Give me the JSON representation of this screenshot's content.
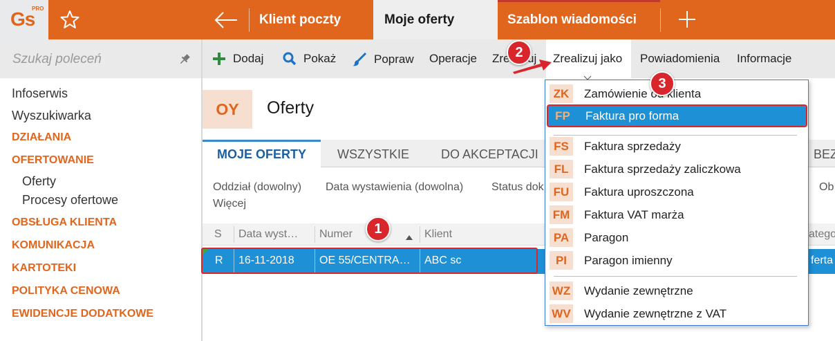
{
  "logo": {
    "text": "Gs",
    "superscript": "PRO"
  },
  "top_tabs": [
    {
      "label": "Klient poczty"
    },
    {
      "label": "Moje oferty"
    },
    {
      "label": "Szablon wiadomości"
    }
  ],
  "sidebar": {
    "search_placeholder": "Szukaj poleceń",
    "items": [
      {
        "label": "Infoserwis",
        "kind": "plain"
      },
      {
        "label": "Wyszukiwarka",
        "kind": "plain"
      },
      {
        "label": "DZIAŁANIA",
        "kind": "section"
      },
      {
        "label": "OFERTOWANIE",
        "kind": "section"
      },
      {
        "label": "Oferty",
        "kind": "sub"
      },
      {
        "label": "Procesy ofertowe",
        "kind": "sub"
      },
      {
        "label": "OBSŁUGA KLIENTA",
        "kind": "section"
      },
      {
        "label": "KOMUNIKACJA",
        "kind": "section"
      },
      {
        "label": "KARTOTEKI",
        "kind": "section"
      },
      {
        "label": "POLITYKA CENOWA",
        "kind": "section"
      },
      {
        "label": "EWIDENCJE DODATKOWE",
        "kind": "section"
      }
    ]
  },
  "toolbar": {
    "dodaj": "Dodaj",
    "pokaz": "Pokaż",
    "popraw": "Popraw",
    "operacje": "Operacje",
    "zrealizuj": "Zrealizuj",
    "zrealizuj_jako": "Zrealizuj jako",
    "powiadomienia": "Powiadomienia",
    "informacje": "Informacje"
  },
  "header": {
    "badge": "OY",
    "title": "Oferty"
  },
  "sub_tabs": [
    {
      "label": "MOJE OFERTY"
    },
    {
      "label": "WSZYSTKIE"
    },
    {
      "label": "DO AKCEPTACJI"
    },
    {
      "label": "BEZ"
    }
  ],
  "filters": {
    "oddzial": "Oddział (dowolny)",
    "data": "Data wystawienia (dowolna)",
    "status": "Status dok",
    "more": "Więcej",
    "right_partial": "Ob"
  },
  "grid": {
    "columns": [
      "S",
      "Data wyst…",
      "Numer",
      "Klient"
    ],
    "right_partial_header": "atego",
    "row": {
      "s": "R",
      "data": "16-11-2018",
      "numer": "OE 55/CENTRA…",
      "klient": "ABC sc",
      "right_partial": "ferta"
    }
  },
  "dropdown": {
    "items": [
      {
        "code": "ZK",
        "label": "Zamówienie od klienta"
      },
      {
        "code": "FP",
        "label": "Faktura pro forma"
      },
      {
        "code": "FS",
        "label": "Faktura sprzedaży"
      },
      {
        "code": "FL",
        "label": "Faktura sprzedaży zaliczkowa"
      },
      {
        "code": "FU",
        "label": "Faktura uproszczona"
      },
      {
        "code": "FM",
        "label": "Faktura VAT marża"
      },
      {
        "code": "PA",
        "label": "Paragon"
      },
      {
        "code": "PI",
        "label": "Paragon imienny"
      },
      {
        "code": "WZ",
        "label": "Wydanie zewnętrzne"
      },
      {
        "code": "WV",
        "label": "Wydanie zewnętrzne z VAT"
      }
    ]
  },
  "step_badges": [
    "1",
    "2",
    "3"
  ],
  "colors": {
    "accent": "#e0661e",
    "selection": "#1e90d6",
    "highlight": "#d9262c"
  }
}
